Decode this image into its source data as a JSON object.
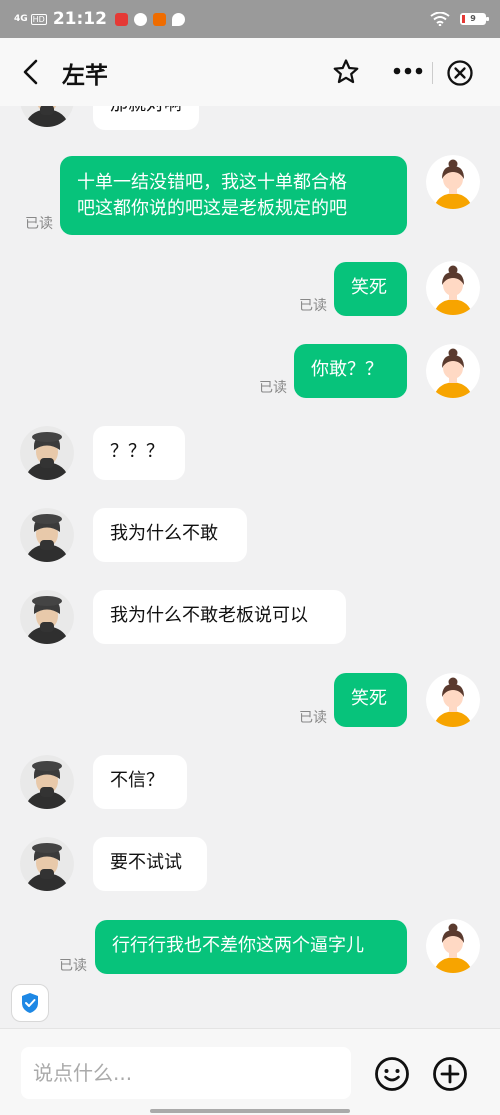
{
  "status_bar": {
    "network": "4G",
    "hd": "HD",
    "time": "21:12",
    "battery_level": "9"
  },
  "header": {
    "title": "左芊"
  },
  "messages": [
    {
      "side": "in",
      "text": "那就对啊"
    },
    {
      "side": "out",
      "line1": "十单一结没错吧，我这十单都合格",
      "line2": "吧这都你说的吧这是老板规定的吧",
      "read": "已读"
    },
    {
      "side": "out",
      "text": "笑死",
      "read": "已读"
    },
    {
      "side": "out",
      "text": "你敢？？",
      "read": "已读"
    },
    {
      "side": "in",
      "text": "？？？"
    },
    {
      "side": "in",
      "text": "我为什么不敢"
    },
    {
      "side": "in",
      "text": "我为什么不敢老板说可以"
    },
    {
      "side": "out",
      "text": "笑死",
      "read": "已读"
    },
    {
      "side": "in",
      "text": "不信？"
    },
    {
      "side": "in",
      "text": "要不试试"
    },
    {
      "side": "out",
      "text": "行行行我也不差你这两个逼字儿",
      "read": "已读"
    }
  ],
  "composer": {
    "placeholder": "说点什么..."
  },
  "colors": {
    "accent_green": "#07c37b",
    "background": "#f1f1f2"
  },
  "icons": [
    "back-arrow-icon",
    "star-icon",
    "more-icon",
    "close-circle-icon",
    "smile-icon",
    "plus-circle-icon",
    "shield-check-icon"
  ]
}
